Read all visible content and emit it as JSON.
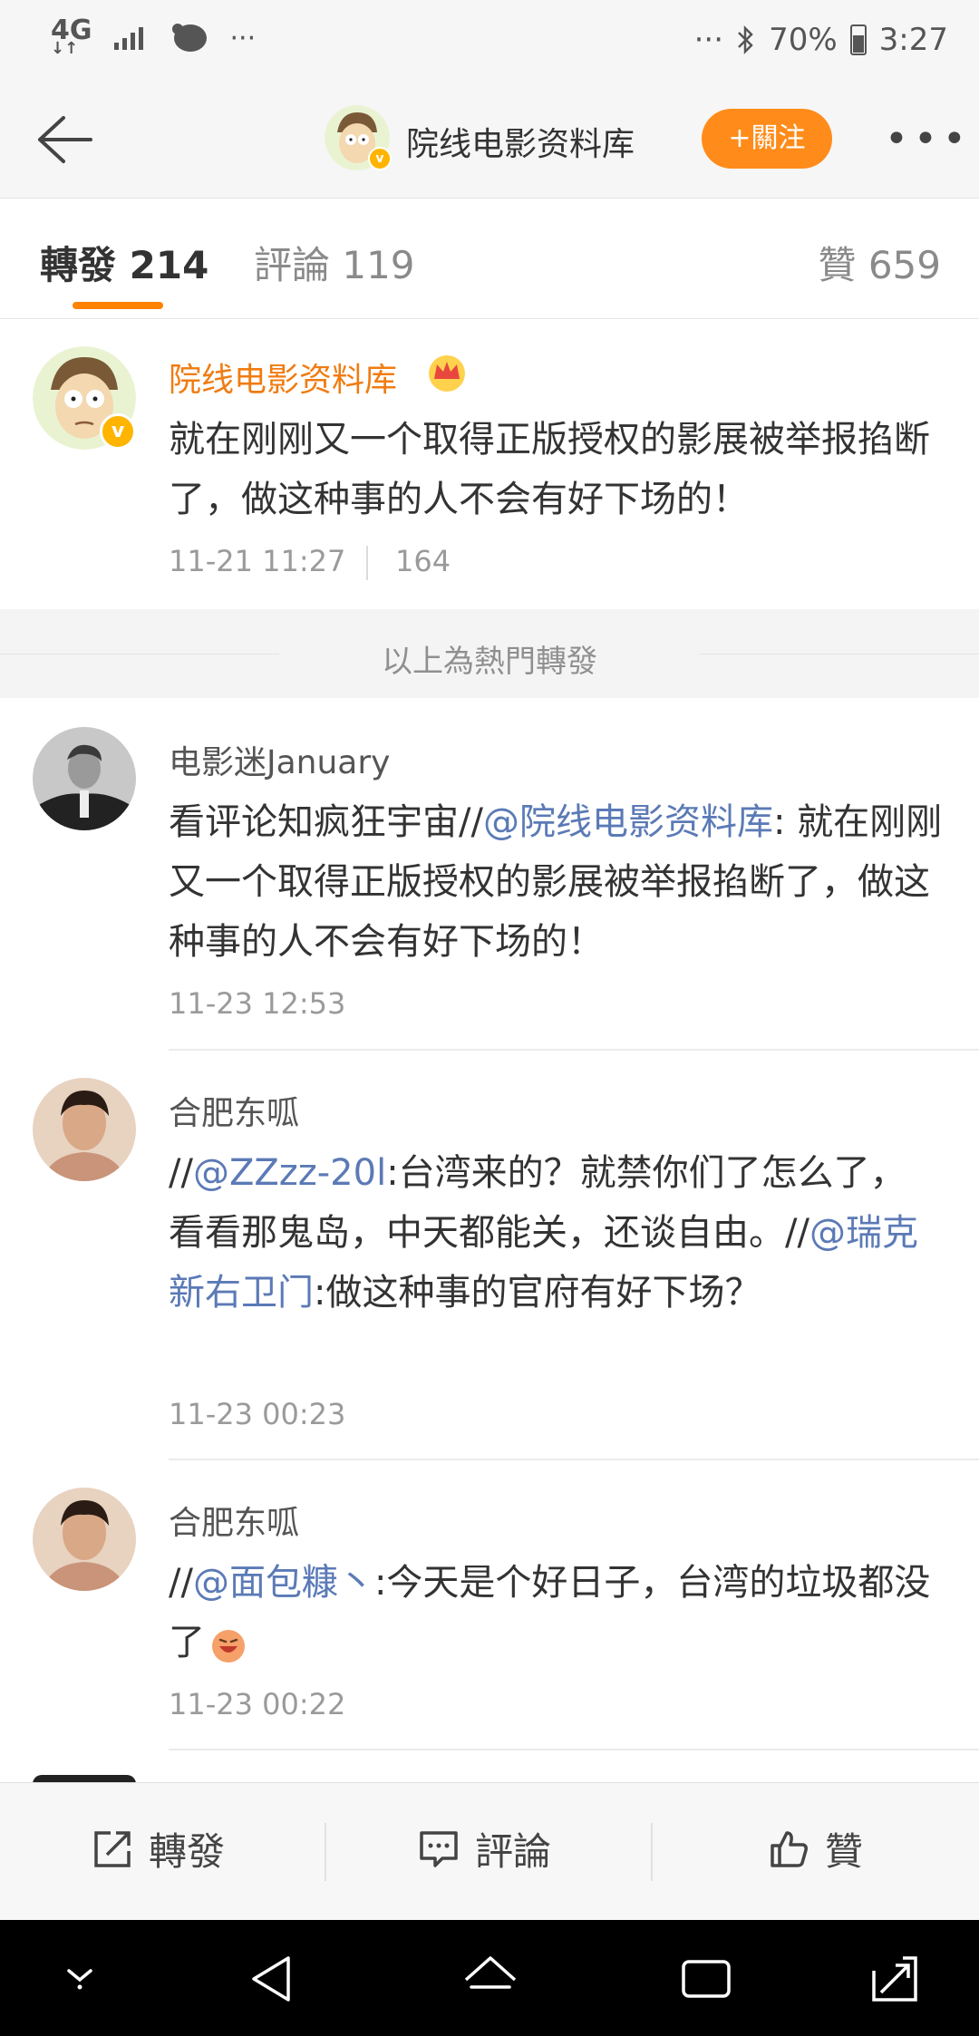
{
  "status_bar": {
    "network": "4G",
    "network_sub": "↓↑",
    "left_more": "···",
    "right_more": "···",
    "battery": "70%",
    "time": "3:27"
  },
  "header": {
    "title": "院线电影资料库",
    "follow_label": "+關注",
    "more_label": "•••"
  },
  "tabs": {
    "repost": "轉發 214",
    "comment": "評論 119",
    "like": "贊 659"
  },
  "hot_post": {
    "name": "院线电影资料库",
    "text": "就在刚刚又一个取得正版授权的影展被举报掐断了，做这种事的人不会有好下场的！",
    "time": "11-21 11:27",
    "likes": "164"
  },
  "hot_separator": "以上為熱門轉發",
  "reposts": [
    {
      "name": "电影迷January",
      "text_prefix": "看评论知疯狂宇宙//",
      "mention": "@院线电影资料库",
      "text_suffix": ": 就在刚刚又一个取得正版授权的影展被举报掐断了，做这种事的人不会有好下场的！",
      "time": "11-23 12:53"
    },
    {
      "name": "合肥东呱",
      "slash1": "//",
      "mention1": "@ZZzz-20l",
      "text1": ":台湾来的？就禁你们了怎么了，看看那鬼岛，中天都能关，还谈自由。//",
      "mention2": "@瑞克新右卫门",
      "text2": ":做这种事的官府有好下场？",
      "time": "11-23 00:23"
    },
    {
      "name": "合肥东呱",
      "slash": "//",
      "mention": "@面包糠丶",
      "text": ":今天是个好日子，台湾的垃圾都没了",
      "time": "11-23 00:22"
    }
  ],
  "actions": {
    "repost": "轉發",
    "comment": "評論",
    "like": "贊"
  },
  "colors": {
    "accent_orange": "#ff8200",
    "follow_bg": "#ff8c1a",
    "mention_blue": "#5b7ab6",
    "verified_badge": "#ffb400"
  }
}
